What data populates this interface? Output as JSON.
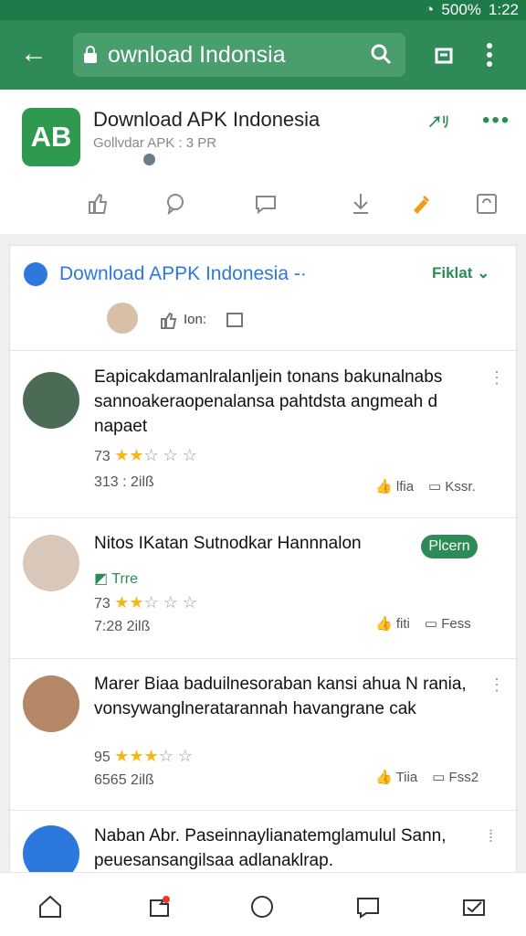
{
  "status": {
    "battery": "500%",
    "time": "1:22"
  },
  "toolbar": {
    "url": "ownload Indonsia"
  },
  "app": {
    "title": "Download APK Indonesia",
    "subtitle": "Gollvdar APK : 3 PR",
    "logo": "AB"
  },
  "panel": {
    "title_prefix": "Download",
    "title_accent": "APPK Indonesia -·",
    "right": "Fiklat",
    "small_text": "Ion:"
  },
  "reviews": [
    {
      "text": "Eapicakdamanlralanljein tonans bakunalnabs sannoakeraopenalansa pahtdsta angmeah d napaet",
      "rating": "73",
      "time": "313 : 2ilß",
      "action1": "lfia",
      "action2": "Kssr."
    },
    {
      "text": "Nitos IKatan Sutnodkar Hannnalon",
      "badge": "Plcern",
      "tag": "Trre",
      "rating": "73",
      "time": "7:28 2ilß",
      "action1": "fiti",
      "action2": "Fess"
    },
    {
      "text": "Marer Biaa baduilnesoraban kansi ahua N rania, vonsywanglneratarannah havangrane cak",
      "rating": "95",
      "time": "6565 2ilß",
      "action1": "Tiia",
      "action2": "Fss2"
    },
    {
      "text": "Naban Abr. Paseinnaylianatemglamulul Sann, peuesansangilsaa adlanaklrap.",
      "rating": "",
      "time": "",
      "action1": "",
      "action2": ""
    }
  ]
}
